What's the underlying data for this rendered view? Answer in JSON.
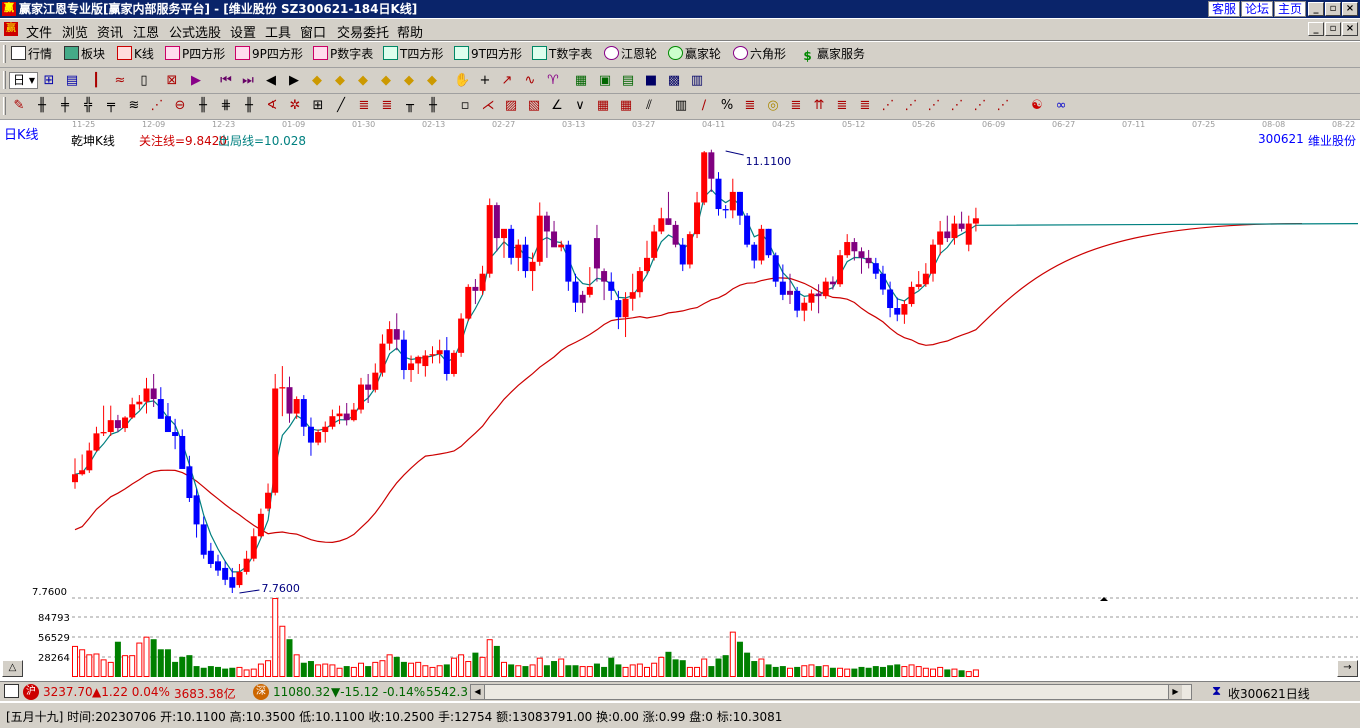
{
  "window": {
    "title": "赢家江恩专业版[赢家内部服务平台] - [维业股份  SZ300621-184日K线]",
    "links": [
      "客服",
      "论坛",
      "主页"
    ],
    "app_icon": "赢",
    "controls": [
      "_",
      "▫",
      "×"
    ]
  },
  "menu": {
    "items": [
      "文件",
      "浏览",
      "资讯",
      "江恩",
      "公式选股",
      "设置",
      "工具",
      "窗口",
      "交易委托",
      "帮助"
    ]
  },
  "toolbar1": {
    "items": [
      {
        "label": "行情",
        "icon": "grid-icon"
      },
      {
        "label": "板块",
        "icon": "blocks-icon"
      },
      {
        "label": "K线",
        "icon": "candles-icon"
      },
      {
        "label": "P四方形",
        "icon": "ps-icon"
      },
      {
        "label": "9P四方形",
        "icon": "p9-icon"
      },
      {
        "label": "P数字表",
        "icon": "pn-icon"
      },
      {
        "label": "T四方形",
        "icon": "ts-icon"
      },
      {
        "label": "9T四方形",
        "icon": "t9-icon"
      },
      {
        "label": "T数字表",
        "icon": "tn-icon"
      },
      {
        "label": "江恩轮",
        "icon": "gann-wheel-icon"
      },
      {
        "label": "赢家轮",
        "icon": "winner-wheel-icon"
      },
      {
        "label": "六角形",
        "icon": "hexagon-icon"
      },
      {
        "label": "赢家服务",
        "icon": "dollar-icon"
      }
    ]
  },
  "period": {
    "value": "日"
  },
  "chart_header": {
    "period_label": "日K线",
    "indicator": "乾坤K线",
    "focus_line": "关注线=9.8420",
    "exit_line": "出局线=10.028",
    "code": "300621",
    "name": "维业股份"
  },
  "chart_data": {
    "type": "candlestick",
    "date_ticks": [
      "11-25",
      "12-09",
      "12-23",
      "01-09",
      "01-30",
      "02-13",
      "02-27",
      "03-13",
      "03-27",
      "04-11",
      "04-25",
      "05-12",
      "05-26",
      "06-09",
      "06-27",
      "07-11",
      "07-25",
      "08-08",
      "08-22"
    ],
    "price_label": "7.7600",
    "high_annotation": "11.1100",
    "low_annotation": "7.7600",
    "volume_ticks": [
      "84793",
      "56529",
      "28264"
    ],
    "colors": {
      "up": "#ff0000",
      "down": "#0000ff",
      "neutral": "#800080",
      "volume_up": "#ff0000",
      "volume_down": "#008000",
      "fast_ma": "#008080",
      "slow_ma": "#cc0000"
    },
    "candles": [
      [
        8.6,
        8.78,
        8.55,
        8.66
      ],
      [
        8.66,
        8.81,
        8.65,
        8.69
      ],
      [
        8.69,
        8.9,
        8.67,
        8.84
      ],
      [
        8.84,
        9.02,
        8.83,
        8.97
      ],
      [
        8.97,
        9.18,
        8.95,
        8.98
      ],
      [
        8.98,
        9.18,
        8.95,
        9.07
      ],
      [
        9.07,
        9.11,
        8.98,
        9.01
      ],
      [
        9.01,
        9.1,
        8.98,
        9.09
      ],
      [
        9.09,
        9.24,
        9.08,
        9.19
      ],
      [
        9.19,
        9.26,
        9.15,
        9.21
      ],
      [
        9.21,
        9.39,
        9.12,
        9.31
      ],
      [
        9.31,
        9.42,
        9.17,
        9.23
      ],
      [
        9.23,
        9.32,
        9.1,
        9.08
      ],
      [
        9.1,
        9.2,
        8.99,
        8.98
      ],
      [
        8.98,
        9.08,
        8.85,
        8.95
      ],
      [
        8.95,
        9.0,
        8.74,
        8.7
      ],
      [
        8.72,
        8.8,
        8.45,
        8.48
      ],
      [
        8.5,
        8.55,
        8.18,
        8.28
      ],
      [
        8.28,
        8.34,
        8.02,
        8.05
      ],
      [
        8.08,
        8.14,
        7.95,
        7.98
      ],
      [
        8.0,
        8.05,
        7.89,
        7.93
      ],
      [
        7.95,
        8.0,
        7.82,
        7.86
      ],
      [
        7.88,
        7.95,
        7.76,
        7.8
      ],
      [
        7.82,
        7.98,
        7.8,
        7.92
      ],
      [
        7.92,
        8.08,
        7.9,
        8.02
      ],
      [
        8.02,
        8.25,
        8.0,
        8.19
      ],
      [
        8.19,
        8.4,
        8.18,
        8.36
      ],
      [
        8.4,
        8.59,
        8.38,
        8.52
      ],
      [
        8.52,
        9.42,
        8.5,
        9.31
      ],
      [
        9.31,
        9.48,
        9.1,
        9.32
      ],
      [
        9.32,
        9.4,
        9.05,
        9.12
      ],
      [
        9.12,
        9.25,
        9.08,
        9.23
      ],
      [
        9.23,
        9.26,
        8.95,
        9.02
      ],
      [
        9.02,
        9.09,
        8.8,
        8.9
      ],
      [
        8.9,
        9.0,
        8.88,
        8.98
      ],
      [
        8.98,
        9.06,
        8.9,
        9.02
      ],
      [
        9.02,
        9.15,
        9.0,
        9.1
      ],
      [
        9.1,
        9.18,
        9.04,
        9.12
      ],
      [
        9.12,
        9.2,
        9.03,
        9.07
      ],
      [
        9.07,
        9.2,
        9.06,
        9.15
      ],
      [
        9.15,
        9.39,
        9.12,
        9.34
      ],
      [
        9.34,
        9.42,
        9.2,
        9.3
      ],
      [
        9.3,
        9.5,
        9.28,
        9.43
      ],
      [
        9.43,
        9.72,
        9.4,
        9.65
      ],
      [
        9.65,
        9.82,
        9.6,
        9.76
      ],
      [
        9.76,
        9.88,
        9.6,
        9.68
      ],
      [
        9.68,
        9.75,
        9.38,
        9.45
      ],
      [
        9.45,
        9.56,
        9.36,
        9.5
      ],
      [
        9.5,
        9.56,
        9.42,
        9.55
      ],
      [
        9.48,
        9.6,
        9.4,
        9.56
      ],
      [
        9.56,
        9.63,
        9.5,
        9.57
      ],
      [
        9.57,
        9.68,
        9.5,
        9.6
      ],
      [
        9.6,
        9.7,
        9.37,
        9.42
      ],
      [
        9.42,
        9.6,
        9.4,
        9.58
      ],
      [
        9.58,
        9.88,
        9.55,
        9.84
      ],
      [
        9.84,
        10.1,
        9.82,
        10.08
      ],
      [
        10.08,
        10.14,
        9.95,
        10.05
      ],
      [
        10.05,
        10.24,
        10.02,
        10.18
      ],
      [
        10.18,
        10.75,
        10.15,
        10.7
      ],
      [
        10.7,
        10.72,
        10.35,
        10.45
      ],
      [
        10.45,
        10.5,
        10.3,
        10.52
      ],
      [
        10.52,
        10.55,
        10.25,
        10.3
      ],
      [
        10.3,
        10.44,
        10.2,
        10.4
      ],
      [
        10.4,
        10.46,
        10.15,
        10.2
      ],
      [
        10.2,
        10.34,
        10.05,
        10.27
      ],
      [
        10.27,
        10.72,
        10.24,
        10.62
      ],
      [
        10.62,
        10.65,
        10.3,
        10.5
      ],
      [
        10.5,
        10.58,
        10.4,
        10.38
      ],
      [
        10.38,
        10.43,
        10.35,
        10.4
      ],
      [
        10.4,
        10.43,
        10.05,
        10.12
      ],
      [
        10.12,
        10.18,
        9.89,
        9.96
      ],
      [
        9.96,
        10.05,
        9.88,
        10.02
      ],
      [
        10.02,
        10.23,
        10.0,
        10.08
      ],
      [
        10.45,
        10.55,
        10.12,
        10.22
      ],
      [
        10.2,
        10.22,
        9.98,
        10.12
      ],
      [
        10.12,
        10.19,
        9.98,
        10.05
      ],
      [
        9.98,
        10.05,
        9.76,
        9.85
      ],
      [
        9.85,
        10.04,
        9.7,
        9.99
      ],
      [
        9.99,
        10.18,
        9.9,
        10.04
      ],
      [
        10.04,
        10.23,
        10.0,
        10.2
      ],
      [
        10.2,
        10.43,
        10.18,
        10.3
      ],
      [
        10.3,
        10.55,
        10.28,
        10.5
      ],
      [
        10.5,
        10.68,
        10.48,
        10.6
      ],
      [
        10.6,
        10.8,
        10.55,
        10.55
      ],
      [
        10.55,
        10.58,
        10.38,
        10.4
      ],
      [
        10.4,
        10.45,
        10.2,
        10.25
      ],
      [
        10.25,
        10.5,
        10.22,
        10.48
      ],
      [
        10.48,
        10.8,
        10.45,
        10.72
      ],
      [
        10.72,
        11.11,
        10.7,
        11.1
      ],
      [
        11.1,
        11.12,
        10.8,
        10.9
      ],
      [
        10.9,
        10.95,
        10.62,
        10.67
      ],
      [
        10.67,
        10.7,
        10.6,
        10.66
      ],
      [
        10.66,
        10.9,
        10.6,
        10.8
      ],
      [
        10.8,
        10.8,
        10.55,
        10.62
      ],
      [
        10.62,
        10.64,
        10.38,
        10.4
      ],
      [
        10.4,
        10.42,
        10.22,
        10.28
      ],
      [
        10.28,
        10.55,
        10.25,
        10.52
      ],
      [
        10.52,
        10.52,
        10.3,
        10.32
      ],
      [
        10.32,
        10.34,
        10.08,
        10.12
      ],
      [
        10.12,
        10.25,
        9.98,
        10.02
      ],
      [
        10.02,
        10.18,
        9.95,
        10.05
      ],
      [
        10.05,
        10.08,
        9.85,
        9.9
      ],
      [
        9.9,
        10.0,
        9.82,
        9.96
      ],
      [
        9.96,
        10.06,
        9.9,
        10.03
      ],
      [
        10.03,
        10.1,
        9.88,
        10.01
      ],
      [
        10.01,
        10.15,
        9.99,
        10.12
      ],
      [
        10.12,
        10.16,
        10.06,
        10.1
      ],
      [
        10.1,
        10.36,
        10.08,
        10.32
      ],
      [
        10.32,
        10.48,
        10.3,
        10.42
      ],
      [
        10.42,
        10.45,
        10.28,
        10.35
      ],
      [
        10.35,
        10.38,
        10.18,
        10.3
      ],
      [
        10.3,
        10.36,
        10.22,
        10.26
      ],
      [
        10.26,
        10.3,
        10.14,
        10.18
      ],
      [
        10.18,
        10.24,
        10.02,
        10.06
      ],
      [
        10.06,
        10.12,
        9.85,
        9.92
      ],
      [
        9.92,
        10.0,
        9.82,
        9.87
      ],
      [
        9.87,
        9.98,
        9.8,
        9.95
      ],
      [
        9.95,
        10.12,
        9.93,
        10.08
      ],
      [
        10.08,
        10.2,
        10.06,
        10.1
      ],
      [
        10.1,
        10.26,
        10.08,
        10.18
      ],
      [
        10.18,
        10.44,
        10.12,
        10.4
      ],
      [
        10.4,
        10.58,
        10.32,
        10.5
      ],
      [
        10.5,
        10.62,
        10.42,
        10.45
      ],
      [
        10.45,
        10.62,
        10.4,
        10.56
      ],
      [
        10.56,
        10.65,
        10.5,
        10.52
      ],
      [
        10.4,
        10.62,
        10.35,
        10.56
      ],
      [
        10.56,
        10.68,
        10.5,
        10.6
      ]
    ],
    "volumes": [
      0.37,
      0.33,
      0.27,
      0.28,
      0.21,
      0.18,
      0.42,
      0.26,
      0.26,
      0.41,
      0.48,
      0.45,
      0.33,
      0.33,
      0.18,
      0.24,
      0.26,
      0.13,
      0.11,
      0.13,
      0.12,
      0.1,
      0.11,
      0.12,
      0.09,
      0.1,
      0.16,
      0.2,
      0.94,
      0.61,
      0.45,
      0.27,
      0.17,
      0.19,
      0.15,
      0.16,
      0.15,
      0.11,
      0.13,
      0.12,
      0.17,
      0.13,
      0.18,
      0.2,
      0.27,
      0.24,
      0.18,
      0.17,
      0.18,
      0.14,
      0.12,
      0.14,
      0.15,
      0.23,
      0.27,
      0.19,
      0.29,
      0.24,
      0.45,
      0.37,
      0.18,
      0.15,
      0.14,
      0.13,
      0.15,
      0.23,
      0.14,
      0.19,
      0.22,
      0.14,
      0.14,
      0.13,
      0.13,
      0.16,
      0.12,
      0.23,
      0.15,
      0.12,
      0.15,
      0.16,
      0.12,
      0.17,
      0.24,
      0.3,
      0.21,
      0.2,
      0.12,
      0.12,
      0.22,
      0.13,
      0.22,
      0.26,
      0.54,
      0.42,
      0.29,
      0.19,
      0.22,
      0.15,
      0.12,
      0.13,
      0.11,
      0.12,
      0.14,
      0.15,
      0.13,
      0.14,
      0.11,
      0.11,
      0.1,
      0.1,
      0.12,
      0.11,
      0.13,
      0.12,
      0.14,
      0.15,
      0.13,
      0.15,
      0.13,
      0.11,
      0.1,
      0.12,
      0.09,
      0.1,
      0.08,
      0.07,
      0.09,
      0.09,
      0.08,
      0.07,
      0.08,
      0.06,
      0.08,
      0.08,
      0.07,
      0.06,
      0.07,
      0.06,
      0.06,
      0.05,
      0.06,
      0.07,
      0.06,
      0.05,
      0.05,
      0.06,
      0.07
    ]
  },
  "statusbar": {
    "sh_badge": "沪",
    "sh_index": "3237.70",
    "sh_change": "▲1.22 0.04%",
    "sh_amount": "3683.38亿",
    "sz_badge": "深",
    "sz_index": "11080.32",
    "sz_change": "▼-15.12 -0.14%",
    "sz_amount": "5542.3",
    "receive": "收300621日线"
  },
  "infobar": {
    "text": "[五月十九] 时间:20230706 开:10.1100 高:10.3500 低:10.1100 收:10.2500 手:12754 额:13083791.00 换:0.00 涨:0.99 盘:0 标:10.3081"
  }
}
